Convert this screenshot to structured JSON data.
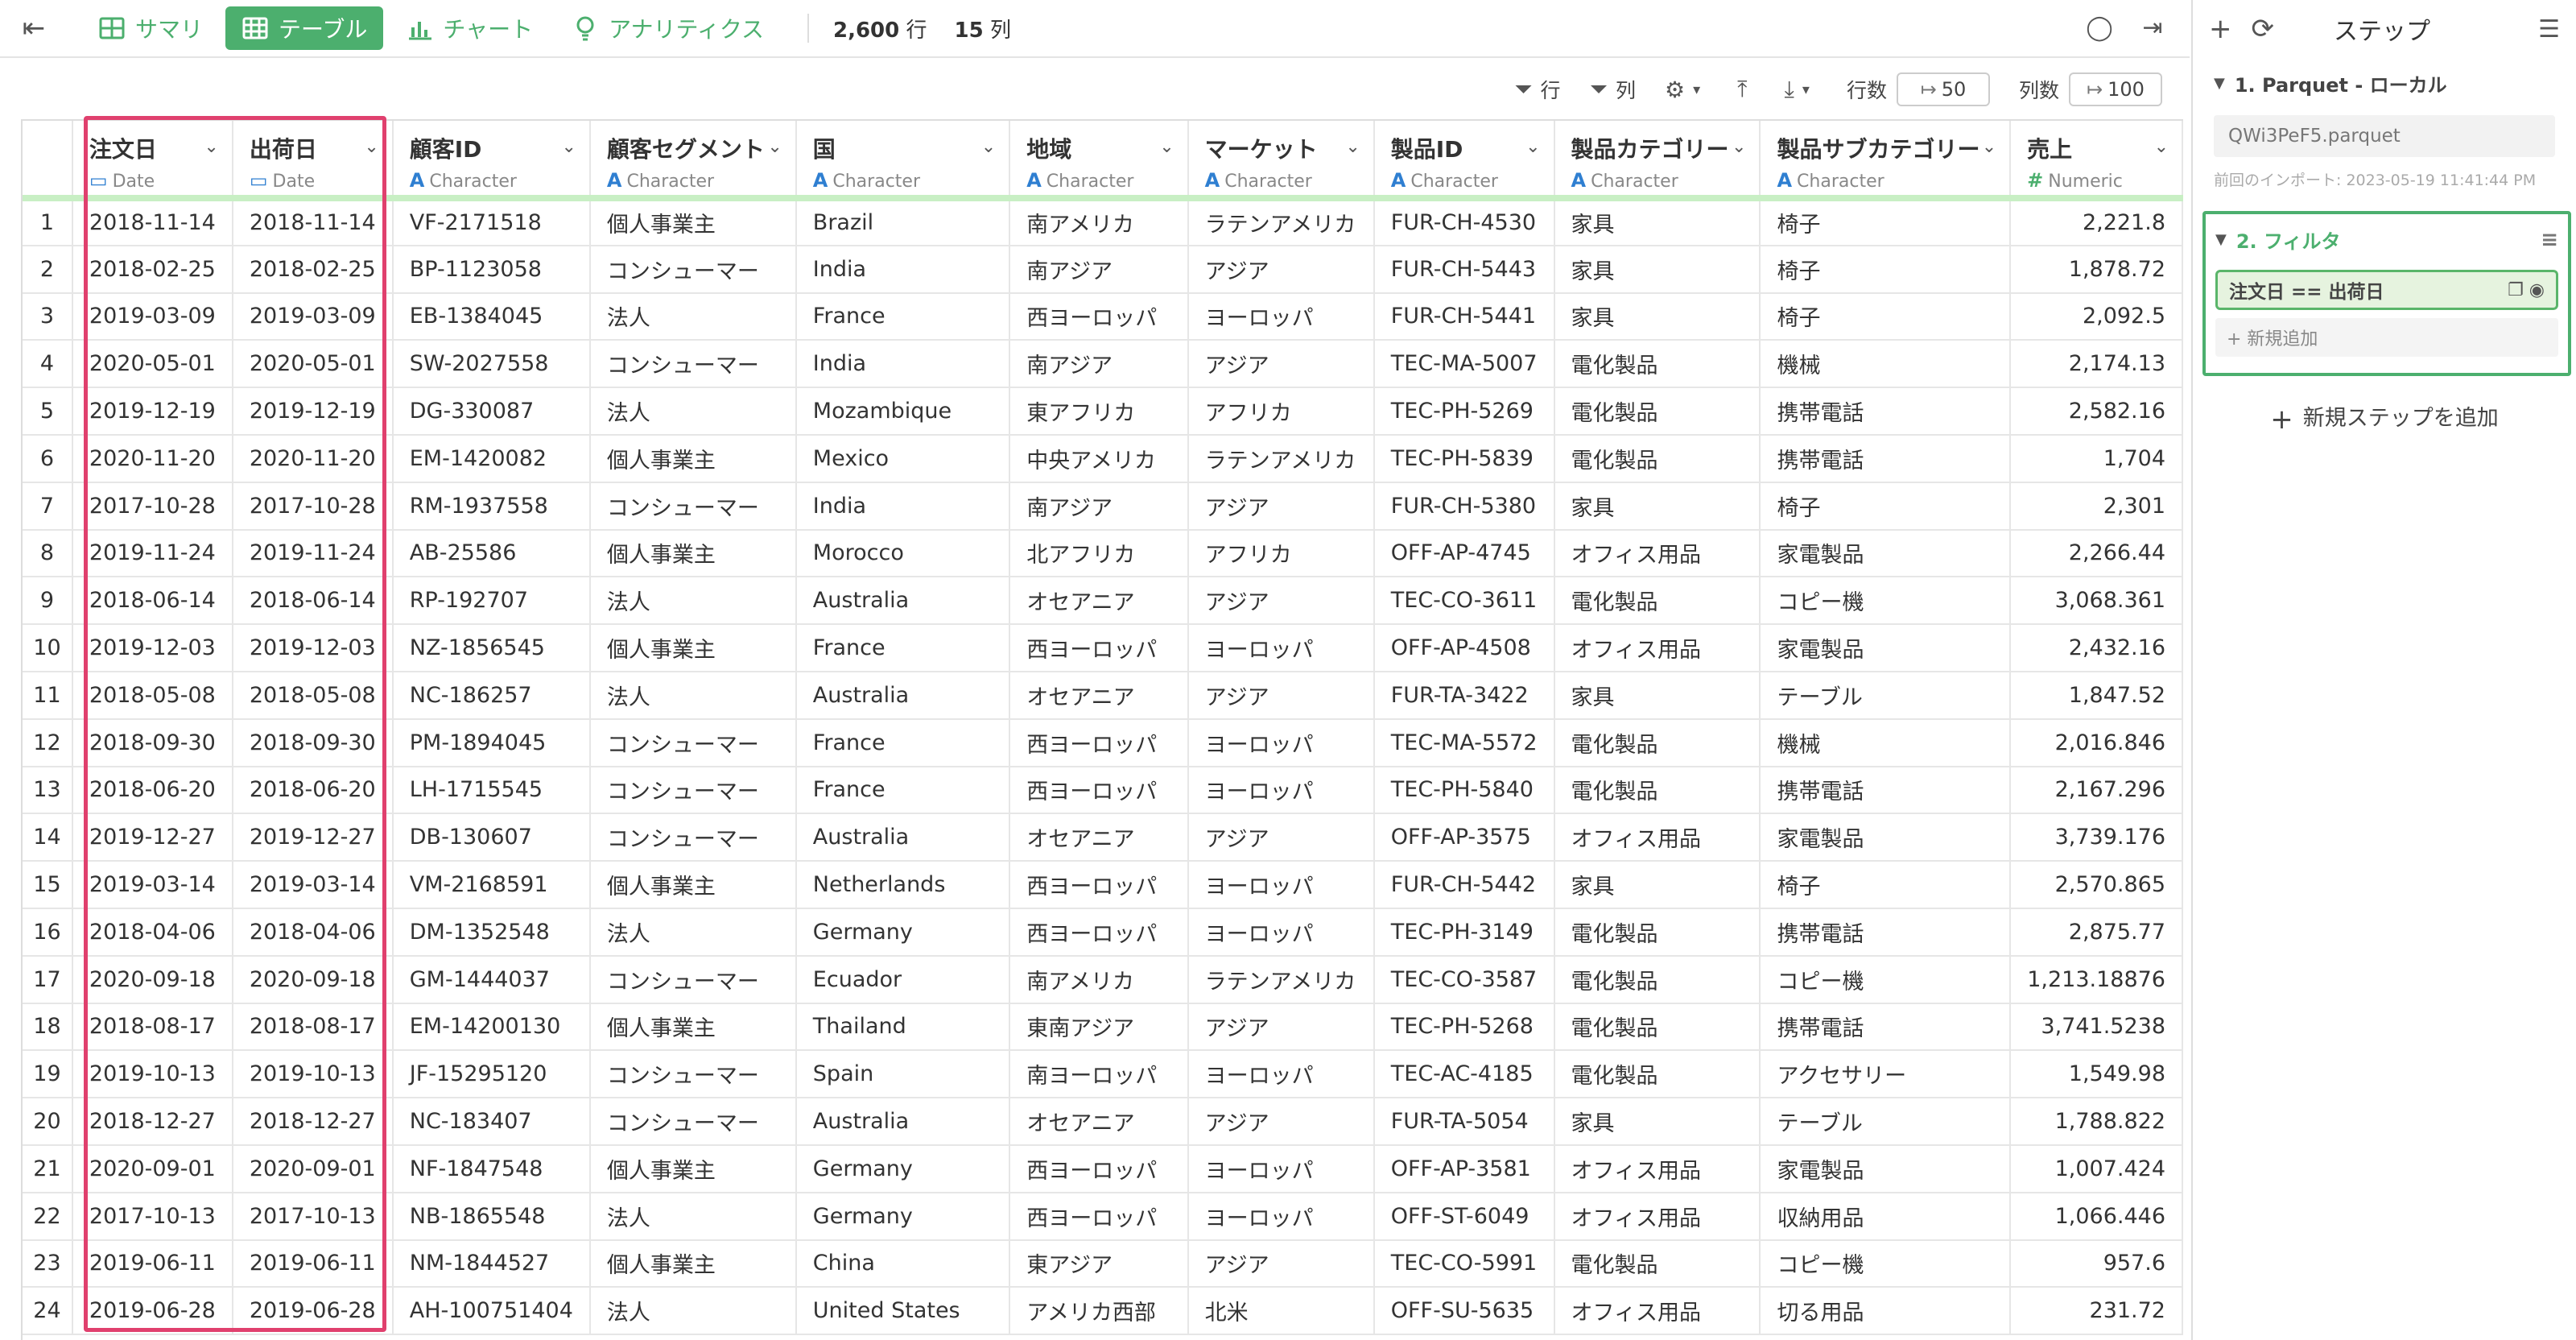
{
  "toolbar": {
    "tabs": [
      {
        "label": "サマリ",
        "icon": "summary-grid-icon"
      },
      {
        "label": "テーブル",
        "icon": "table-grid-icon"
      },
      {
        "label": "チャート",
        "icon": "bar-chart-icon"
      },
      {
        "label": "アナリティクス",
        "icon": "lightbulb-icon"
      }
    ],
    "rows_count": "2,600",
    "rows_unit": "行",
    "cols_count": "15",
    "cols_unit": "列"
  },
  "subbar": {
    "row_filter_label": "行",
    "col_filter_label": "列",
    "row_count_label": "行数",
    "row_count_value": "50",
    "col_count_label": "列数",
    "col_count_value": "100"
  },
  "table": {
    "columns": [
      {
        "name": "注文日",
        "type": "Date"
      },
      {
        "name": "出荷日",
        "type": "Date"
      },
      {
        "name": "顧客ID",
        "type": "Character"
      },
      {
        "name": "顧客セグメント",
        "type": "Character"
      },
      {
        "name": "国",
        "type": "Character"
      },
      {
        "name": "地域",
        "type": "Character"
      },
      {
        "name": "マーケット",
        "type": "Character"
      },
      {
        "name": "製品ID",
        "type": "Character"
      },
      {
        "name": "製品カテゴリー",
        "type": "Character"
      },
      {
        "name": "製品サブカテゴリー",
        "type": "Character"
      },
      {
        "name": "売上",
        "type": "Numeric"
      }
    ],
    "rows": [
      [
        "1",
        "2018-11-14",
        "2018-11-14",
        "VF-2171518",
        "個人事業主",
        "Brazil",
        "南アメリカ",
        "ラテンアメリカ",
        "FUR-CH-4530",
        "家具",
        "椅子",
        "2,221.8"
      ],
      [
        "2",
        "2018-02-25",
        "2018-02-25",
        "BP-1123058",
        "コンシューマー",
        "India",
        "南アジア",
        "アジア",
        "FUR-CH-5443",
        "家具",
        "椅子",
        "1,878.72"
      ],
      [
        "3",
        "2019-03-09",
        "2019-03-09",
        "EB-1384045",
        "法人",
        "France",
        "西ヨーロッパ",
        "ヨーロッパ",
        "FUR-CH-5441",
        "家具",
        "椅子",
        "2,092.5"
      ],
      [
        "4",
        "2020-05-01",
        "2020-05-01",
        "SW-2027558",
        "コンシューマー",
        "India",
        "南アジア",
        "アジア",
        "TEC-MA-5007",
        "電化製品",
        "機械",
        "2,174.13"
      ],
      [
        "5",
        "2019-12-19",
        "2019-12-19",
        "DG-330087",
        "法人",
        "Mozambique",
        "東アフリカ",
        "アフリカ",
        "TEC-PH-5269",
        "電化製品",
        "携帯電話",
        "2,582.16"
      ],
      [
        "6",
        "2020-11-20",
        "2020-11-20",
        "EM-1420082",
        "個人事業主",
        "Mexico",
        "中央アメリカ",
        "ラテンアメリカ",
        "TEC-PH-5839",
        "電化製品",
        "携帯電話",
        "1,704"
      ],
      [
        "7",
        "2017-10-28",
        "2017-10-28",
        "RM-1937558",
        "コンシューマー",
        "India",
        "南アジア",
        "アジア",
        "FUR-CH-5380",
        "家具",
        "椅子",
        "2,301"
      ],
      [
        "8",
        "2019-11-24",
        "2019-11-24",
        "AB-25586",
        "個人事業主",
        "Morocco",
        "北アフリカ",
        "アフリカ",
        "OFF-AP-4745",
        "オフィス用品",
        "家電製品",
        "2,266.44"
      ],
      [
        "9",
        "2018-06-14",
        "2018-06-14",
        "RP-192707",
        "法人",
        "Australia",
        "オセアニア",
        "アジア",
        "TEC-CO-3611",
        "電化製品",
        "コピー機",
        "3,068.361"
      ],
      [
        "10",
        "2019-12-03",
        "2019-12-03",
        "NZ-1856545",
        "個人事業主",
        "France",
        "西ヨーロッパ",
        "ヨーロッパ",
        "OFF-AP-4508",
        "オフィス用品",
        "家電製品",
        "2,432.16"
      ],
      [
        "11",
        "2018-05-08",
        "2018-05-08",
        "NC-186257",
        "法人",
        "Australia",
        "オセアニア",
        "アジア",
        "FUR-TA-3422",
        "家具",
        "テーブル",
        "1,847.52"
      ],
      [
        "12",
        "2018-09-30",
        "2018-09-30",
        "PM-1894045",
        "コンシューマー",
        "France",
        "西ヨーロッパ",
        "ヨーロッパ",
        "TEC-MA-5572",
        "電化製品",
        "機械",
        "2,016.846"
      ],
      [
        "13",
        "2018-06-20",
        "2018-06-20",
        "LH-1715545",
        "コンシューマー",
        "France",
        "西ヨーロッパ",
        "ヨーロッパ",
        "TEC-PH-5840",
        "電化製品",
        "携帯電話",
        "2,167.296"
      ],
      [
        "14",
        "2019-12-27",
        "2019-12-27",
        "DB-130607",
        "コンシューマー",
        "Australia",
        "オセアニア",
        "アジア",
        "OFF-AP-3575",
        "オフィス用品",
        "家電製品",
        "3,739.176"
      ],
      [
        "15",
        "2019-03-14",
        "2019-03-14",
        "VM-2168591",
        "個人事業主",
        "Netherlands",
        "西ヨーロッパ",
        "ヨーロッパ",
        "FUR-CH-5442",
        "家具",
        "椅子",
        "2,570.865"
      ],
      [
        "16",
        "2018-04-06",
        "2018-04-06",
        "DM-1352548",
        "法人",
        "Germany",
        "西ヨーロッパ",
        "ヨーロッパ",
        "TEC-PH-3149",
        "電化製品",
        "携帯電話",
        "2,875.77"
      ],
      [
        "17",
        "2020-09-18",
        "2020-09-18",
        "GM-1444037",
        "コンシューマー",
        "Ecuador",
        "南アメリカ",
        "ラテンアメリカ",
        "TEC-CO-3587",
        "電化製品",
        "コピー機",
        "1,213.18876"
      ],
      [
        "18",
        "2018-08-17",
        "2018-08-17",
        "EM-14200130",
        "個人事業主",
        "Thailand",
        "東南アジア",
        "アジア",
        "TEC-PH-5268",
        "電化製品",
        "携帯電話",
        "3,741.5238"
      ],
      [
        "19",
        "2019-10-13",
        "2019-10-13",
        "JF-15295120",
        "コンシューマー",
        "Spain",
        "南ヨーロッパ",
        "ヨーロッパ",
        "TEC-AC-4185",
        "電化製品",
        "アクセサリー",
        "1,549.98"
      ],
      [
        "20",
        "2018-12-27",
        "2018-12-27",
        "NC-183407",
        "コンシューマー",
        "Australia",
        "オセアニア",
        "アジア",
        "FUR-TA-5054",
        "家具",
        "テーブル",
        "1,788.822"
      ],
      [
        "21",
        "2020-09-01",
        "2020-09-01",
        "NF-1847548",
        "個人事業主",
        "Germany",
        "西ヨーロッパ",
        "ヨーロッパ",
        "OFF-AP-3581",
        "オフィス用品",
        "家電製品",
        "1,007.424"
      ],
      [
        "22",
        "2017-10-13",
        "2017-10-13",
        "NB-1865548",
        "法人",
        "Germany",
        "西ヨーロッパ",
        "ヨーロッパ",
        "OFF-ST-6049",
        "オフィス用品",
        "収納用品",
        "1,066.446"
      ],
      [
        "23",
        "2019-06-11",
        "2019-06-11",
        "NM-1844527",
        "個人事業主",
        "China",
        "東アジア",
        "アジア",
        "TEC-CO-5991",
        "電化製品",
        "コピー機",
        "957.6"
      ],
      [
        "24",
        "2019-06-28",
        "2019-06-28",
        "AH-100751404",
        "法人",
        "United States",
        "アメリカ西部",
        "北米",
        "OFF-SU-5635",
        "オフィス用品",
        "切る用品",
        "231.72"
      ]
    ]
  },
  "panel": {
    "title": "ステップ",
    "step1_title": "1. Parquet - ローカル",
    "step1_file": "QWi3PeF5.parquet",
    "step1_note": "前回のインポート: 2023-05-19 11:41:44 PM",
    "step2_title": "2. フィルタ",
    "step2_filter": "注文日 == 出荷日",
    "step2_add_new": "+ 新規追加",
    "add_step": "新規ステップを追加"
  },
  "colors": {
    "accent_green": "#4caf6e",
    "highlight_pink": "#e0406e",
    "type_blue": "#2f7fd1"
  }
}
